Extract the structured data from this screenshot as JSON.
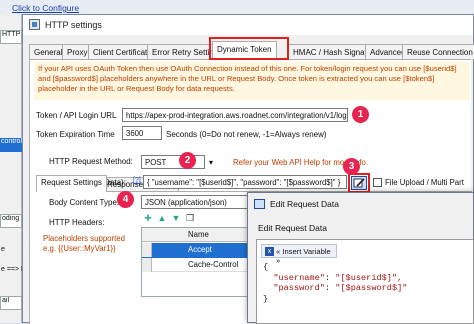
{
  "background": {
    "configure_link": "Click to Configure",
    "left_items": [
      "HTTP",
      "control",
      "oding",
      "e",
      "e ==> F",
      "ail"
    ]
  },
  "window": {
    "title": "HTTP settings"
  },
  "tabs": [
    {
      "label": "General"
    },
    {
      "label": "Proxy"
    },
    {
      "label": "Client Certificate"
    },
    {
      "label": "Error Retry Settings"
    },
    {
      "label": "Dynamic Token"
    },
    {
      "label": "HMAC / Hash Signature"
    },
    {
      "label": "Advanced"
    },
    {
      "label": "Reuse Connection"
    }
  ],
  "warning": "If your API uses OAuth Token then use OAuth Connection instead of this one. For token/login request you can use [$userid$] and [$password$] placeholders anywhere in the URL or Request Body. Once token is extracted you can use [$token$] placeholder in the URL or Request Body for data requests.",
  "token_url": {
    "label": "Token / API Login URL",
    "value": "https://apex-prod-integration.aws.roadnet.com/integration/v1/login"
  },
  "expiration": {
    "label": "Token Expiration Time",
    "value": "3600",
    "note": "Seconds (0=Do not renew, -1=Always renew)"
  },
  "inner_tabs": [
    {
      "label": "Request Settings"
    },
    {
      "label": "Response Settings"
    }
  ],
  "request": {
    "method_label": "HTTP Request Method:",
    "method_value": "POST",
    "help_note": "Refer your Web API Help for more info.",
    "body_label": "Body (Request Data):",
    "body_help": "[?]",
    "body_value": "{  \"username\": \"[$userid$]\",  \"password\": \"[$password$]\" }",
    "upload_label": "File Upload / Multi Part",
    "content_type_label": "Body Content Type:",
    "content_type_value": "JSON (application/json)",
    "headers_label": "HTTP Headers:",
    "placeholder_note_1": "Placeholders supported",
    "placeholder_note_2": "e.g. {{User::MyVar1}}"
  },
  "headers_grid": {
    "column": "Name",
    "rows": [
      "Accept",
      "Cache-Control"
    ]
  },
  "badges": [
    "1",
    "2",
    "3",
    "4"
  ],
  "dialog": {
    "title": "Edit Request Data",
    "heading": "Edit Request Data",
    "insert_variable": "« Insert Variable »",
    "code_open": "{",
    "code_user_key": "\"username\"",
    "code_user_val": "\"[$userid$]\",",
    "code_pass_key": "\"password\"",
    "code_pass_val": "\"[$password$]\"",
    "code_close": "}"
  },
  "colors": {
    "warning_text": "#c04000",
    "highlight": "#e02020",
    "badge": "#e8234f",
    "selection": "#1f6fd1"
  }
}
